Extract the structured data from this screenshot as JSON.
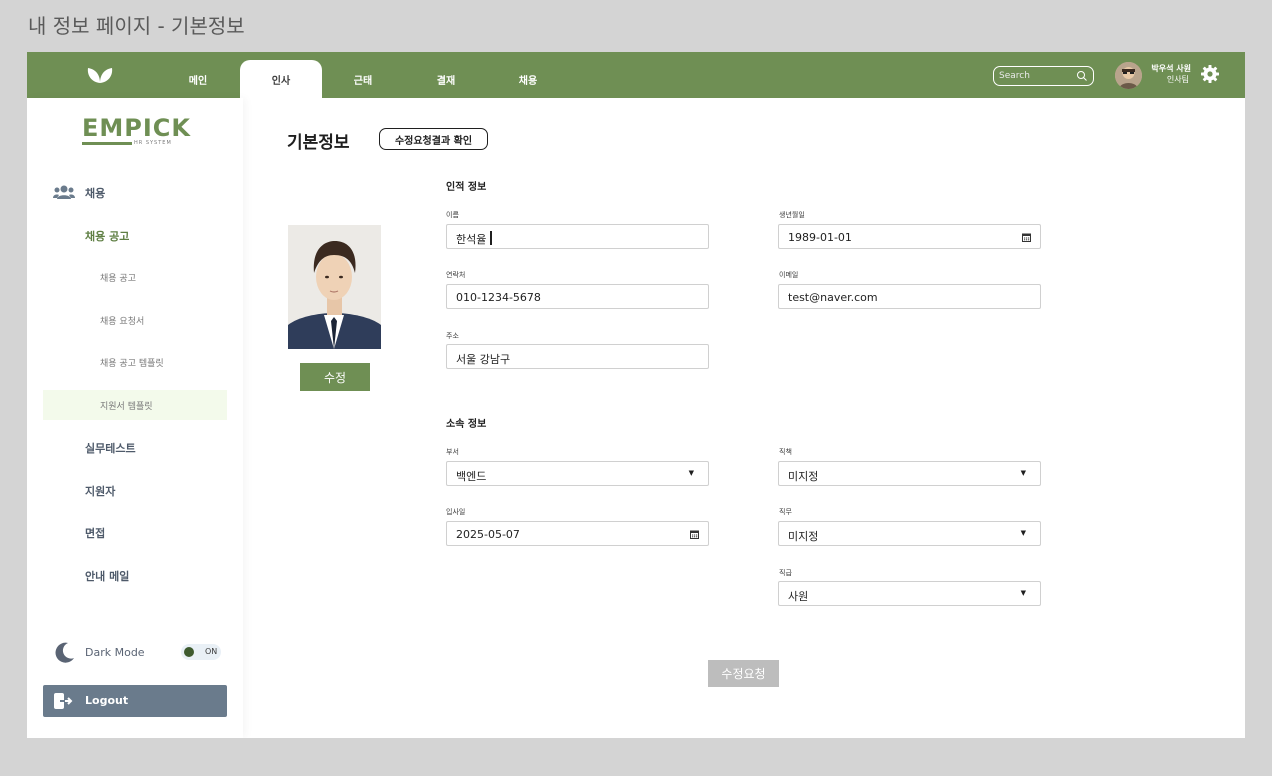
{
  "page_heading": "내 정보 페이지 - 기본정보",
  "topbar": {
    "tabs": [
      {
        "label": "메인"
      },
      {
        "label": "인사"
      },
      {
        "label": "근태"
      },
      {
        "label": "결재"
      },
      {
        "label": "채용"
      }
    ],
    "active_tab": "인사",
    "search_placeholder": "Search",
    "user_name": "박우석 사원",
    "user_team": "인사팀"
  },
  "sidebar": {
    "logo_text": "EMPICK",
    "logo_sub": "HR SYSTEM",
    "menu": {
      "recruit": "채용",
      "recruit_notice": "채용 공고",
      "sub_items": [
        "채용 공고",
        "채용 요청서",
        "채용 공고 템플릿",
        "지원서 템플릿"
      ],
      "practical_test": "실무테스트",
      "applicant": "지원자",
      "interview": "면접",
      "guide_mail": "안내 메일"
    },
    "dark_mode_label": "Dark Mode",
    "dark_mode_state": "ON",
    "logout_label": "Logout"
  },
  "main": {
    "title": "기본정보",
    "result_button": "수정요청결과 확인",
    "personal_section": "인적 정보",
    "fields": {
      "name_label": "이름",
      "name_value": "한석율",
      "birth_label": "생년월일",
      "birth_value": "1989-01-01",
      "phone_label": "연락처",
      "phone_value": "010-1234-5678",
      "email_label": "이메일",
      "email_value": "test@naver.com",
      "address_label": "주소",
      "address_value": "서울 강남구"
    },
    "edit_button": "수정",
    "affiliation_section": "소속 정보",
    "affiliation": {
      "dept_label": "부서",
      "dept_value": "백엔드",
      "position_label": "직책",
      "position_value": "미지정",
      "join_label": "입사일",
      "join_value": "2025-05-07",
      "duty_label": "직무",
      "duty_value": "미지정",
      "rank_label": "직급",
      "rank_value": "사원"
    },
    "request_button": "수정요청"
  },
  "colors": {
    "brand_green": "#6f8f54",
    "logout_bg": "#6a7b8c",
    "disabled_button": "#bdbdbd"
  }
}
